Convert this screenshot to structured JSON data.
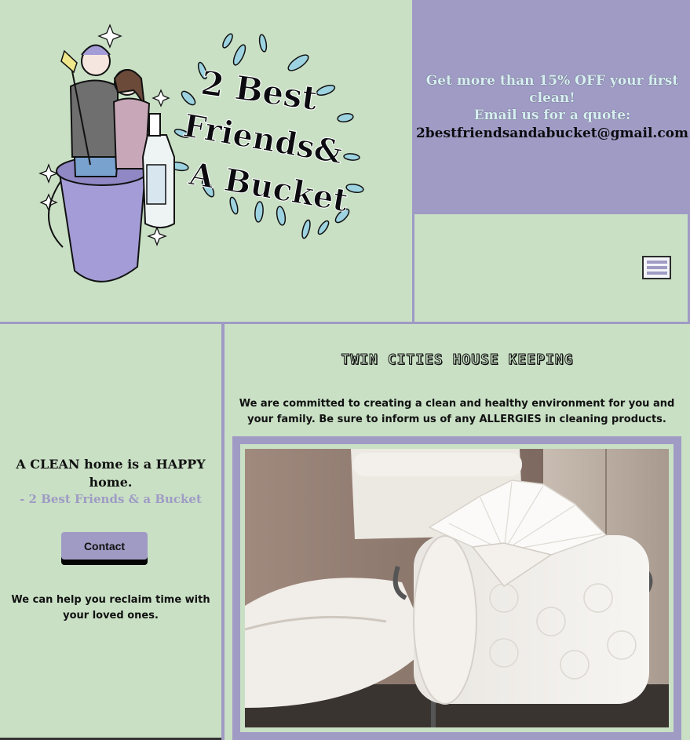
{
  "logo": {
    "brand_line1": "2 Best",
    "brand_line2": "Friends&",
    "brand_line3": "A Bucket"
  },
  "promo": {
    "line1": "Get more than 15% OFF your first clean!",
    "line2": "Email us for a quote:",
    "email": "2bestfriendsandabucket@gmail.com"
  },
  "nav": {
    "menu_icon": "hamburger-menu-icon"
  },
  "left": {
    "tagline": "A CLEAN home is a HAPPY home.",
    "credit": "- 2 Best Friends & a Bucket",
    "contact_label": "Contact",
    "help_text": "We can help you reclaim time with your loved ones."
  },
  "right": {
    "title": "TWIN CITIES HOUSE KEEPING",
    "commitment": "We are committed to creating a clean and healthy environment for you and your family. Be sure to inform us of any ALLERGIES in cleaning products."
  },
  "colors": {
    "background": "#c9e0c5",
    "accent": "#9f9bc4",
    "text": "#111111",
    "promo_text": "#d6f0f2"
  }
}
